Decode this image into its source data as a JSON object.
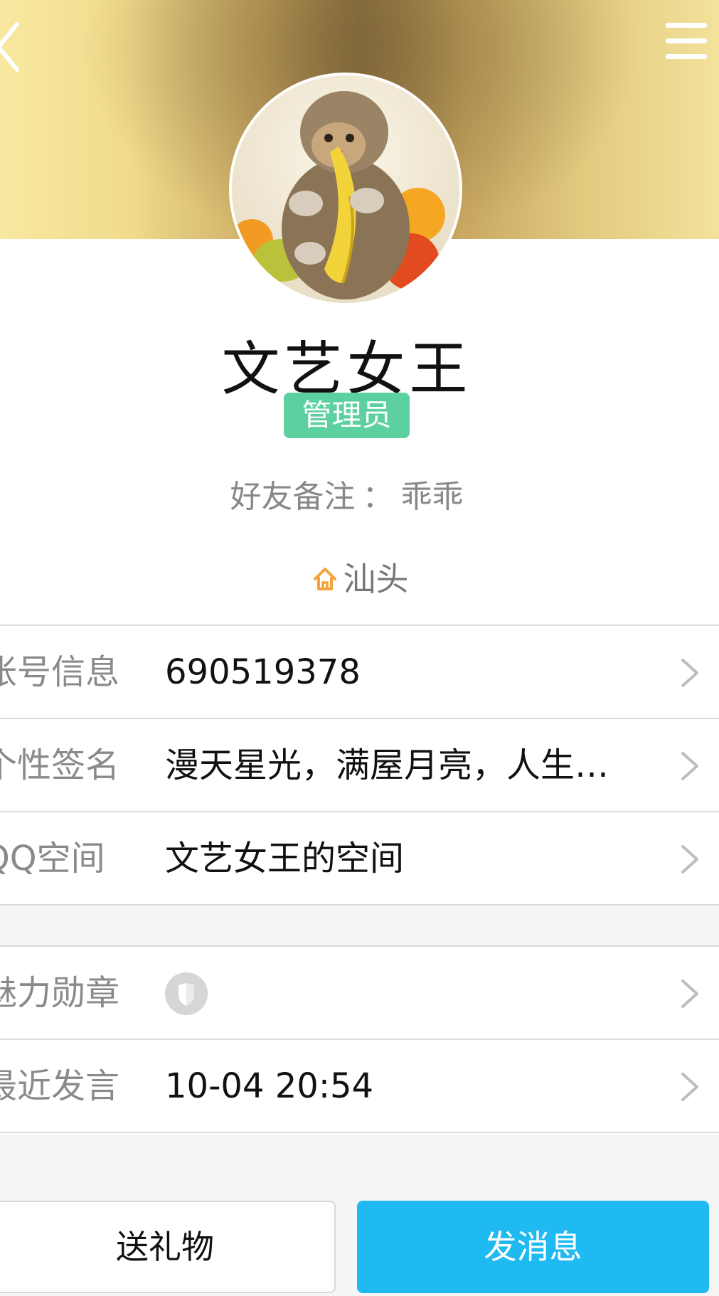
{
  "header": {
    "back_icon": "chevron-left-icon",
    "menu_icon": "menu-icon"
  },
  "profile": {
    "name": "文艺女王",
    "role_badge": "管理员",
    "remark_label": "好友备注",
    "remark_separator": "：",
    "remark_value": "乖乖",
    "location_icon": "home-icon",
    "location": "汕头",
    "badge_color": "#5cd19f"
  },
  "info_rows": [
    {
      "label": "帐号信息",
      "value": "690519378"
    },
    {
      "label": "个性签名",
      "value": "漫天星光，满屋月亮，人生…"
    },
    {
      "label": "QQ空间",
      "value": "文艺女王的空间"
    }
  ],
  "extra_rows": [
    {
      "label": "魅力勋章",
      "value": "",
      "icon": "medal-icon"
    },
    {
      "label": "最近发言",
      "value": "10-04 20:54"
    }
  ],
  "actions": {
    "gift_label": "送礼物",
    "message_label": "发消息",
    "primary_color": "#1fbaf1"
  }
}
